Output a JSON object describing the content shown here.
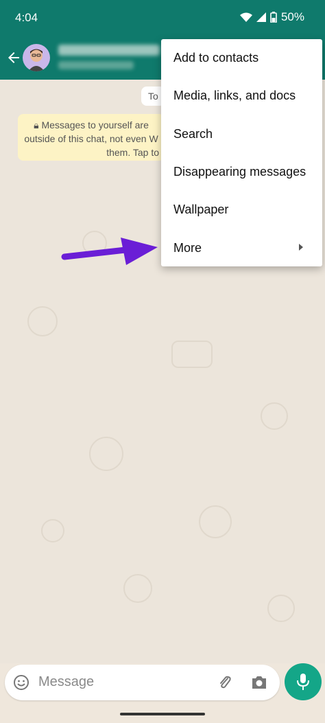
{
  "status_bar": {
    "time": "4:04",
    "battery": "50%"
  },
  "chat": {
    "date_chip": "To",
    "notice_lines": [
      "Messages to yourself are",
      "outside of this chat, not even W",
      "them. Tap to"
    ]
  },
  "menu": {
    "items": [
      {
        "label": "Add to contacts"
      },
      {
        "label": "Media, links, and docs"
      },
      {
        "label": "Search"
      },
      {
        "label": "Disappearing messages"
      },
      {
        "label": "Wallpaper"
      },
      {
        "label": "More"
      }
    ]
  },
  "composer": {
    "placeholder": "Message"
  },
  "colors": {
    "header": "#0f7a6c",
    "accent": "#14a688",
    "annotation_arrow": "#6a1ed6",
    "menu_bg": "#ffffff"
  }
}
